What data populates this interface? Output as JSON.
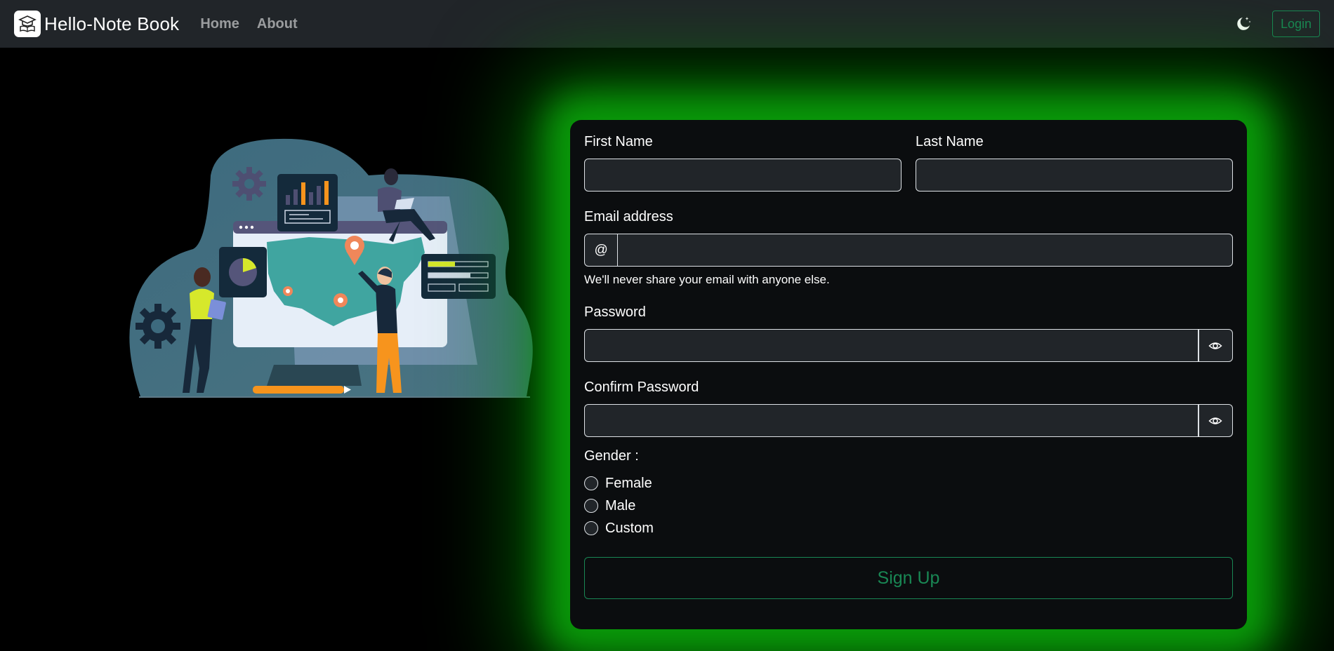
{
  "navbar": {
    "brand": "Hello-Note Book",
    "links": [
      {
        "label": "Home"
      },
      {
        "label": "About"
      }
    ],
    "login_label": "Login"
  },
  "form": {
    "first_name_label": "First Name",
    "first_name_value": "",
    "last_name_label": "Last Name",
    "last_name_value": "",
    "email_label": "Email address",
    "email_addon": "@",
    "email_value": "",
    "email_help": "We'll never share your email with anyone else.",
    "password_label": "Password",
    "password_value": "",
    "confirm_password_label": "Confirm Password",
    "confirm_password_value": "",
    "gender_label": "Gender :",
    "gender_options": [
      {
        "label": "Female",
        "checked": false
      },
      {
        "label": "Male",
        "checked": false
      },
      {
        "label": "Custom",
        "checked": false
      }
    ],
    "submit_label": "Sign Up"
  },
  "colors": {
    "navbar_bg": "#212529",
    "accent_green": "#198754",
    "glow_green": "#0a9a0a",
    "card_bg": "#0b0d0f",
    "input_bg": "#212529"
  },
  "icons": {
    "brand": "graduation-cap-book-icon",
    "theme": "moon-stars-icon",
    "eye": "eye-icon"
  }
}
